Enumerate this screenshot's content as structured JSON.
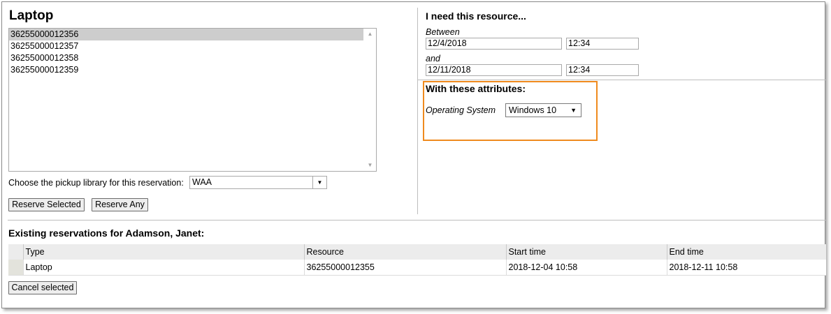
{
  "resource_type": "Laptop",
  "barcodes": [
    {
      "label": "36255000012356",
      "selected": true
    },
    {
      "label": "36255000012357",
      "selected": false
    },
    {
      "label": "36255000012358",
      "selected": false
    },
    {
      "label": "36255000012359",
      "selected": false
    }
  ],
  "pickup": {
    "label": "Choose the pickup library for this reservation:",
    "value": "WAA"
  },
  "buttons": {
    "reserve_selected": "Reserve Selected",
    "reserve_any": "Reserve Any",
    "cancel_selected": "Cancel selected"
  },
  "need": {
    "title": "I need this resource...",
    "between_label": "Between",
    "start_date": "12/4/2018",
    "start_time": "12:34",
    "and_label": "and",
    "end_date": "12/11/2018",
    "end_time": "12:34"
  },
  "attributes": {
    "title": "With these attributes:",
    "os_label": "Operating System",
    "os_value": "Windows 10"
  },
  "existing": {
    "title": "Existing reservations for Adamson, Janet:",
    "columns": [
      "Type",
      "Resource",
      "Start time",
      "End time"
    ],
    "rows": [
      [
        "Laptop",
        "36255000012355",
        "2018-12-04 10:58",
        "2018-12-11 10:58"
      ]
    ]
  },
  "colors": {
    "highlight": "#ef8a1e",
    "selected_row": "#cdcdcd"
  }
}
